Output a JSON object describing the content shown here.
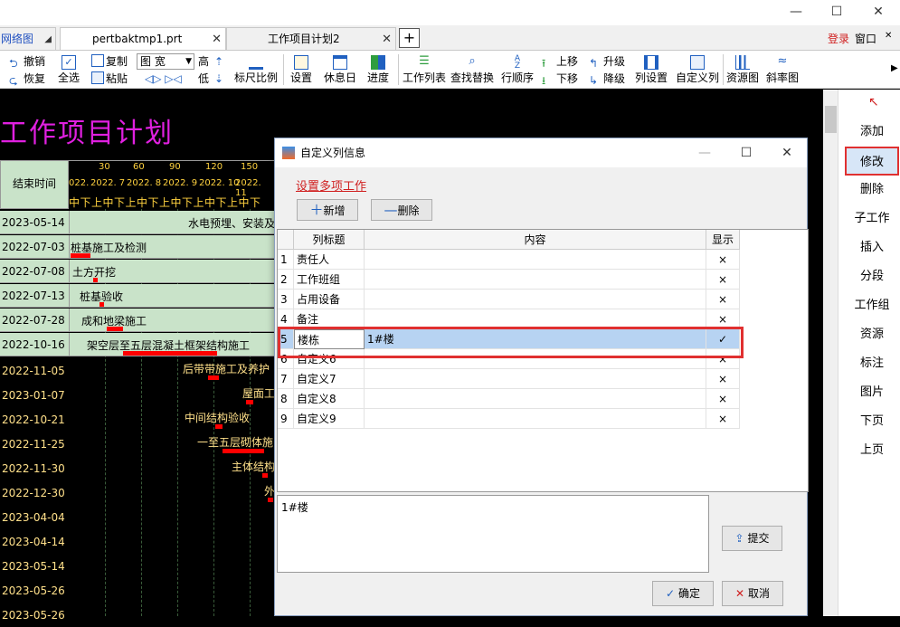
{
  "tabs": {
    "left_partial": "网络图",
    "file_tab": "pertbaktmp1.prt",
    "plan_tab": "工作项目计划2",
    "new_tab": "+",
    "login": "登录",
    "window": "窗口"
  },
  "toolbar": {
    "undo": "撤销",
    "redo": "恢复",
    "select_all": "全选",
    "copy": "复制",
    "paste": "粘贴",
    "view_select": "图  宽",
    "high": "高",
    "low": "低",
    "ruler": "标尺比例",
    "settings": "设置",
    "holiday": "休息日",
    "progress": "进度",
    "work_list": "工作列表",
    "find_replace": "查找替换",
    "row_order": "行顺序",
    "move_up": "上移",
    "move_down": "下移",
    "upgrade": "升级",
    "downgrade": "降级",
    "col_settings": "列设置",
    "custom_col": "自定义列",
    "resource_chart": "资源图",
    "slope_chart": "斜率图"
  },
  "gantt": {
    "title": "工作项目计划",
    "end_time_header": "结束时间",
    "scale_numbers": [
      "30",
      "60",
      "90",
      "120",
      "150"
    ],
    "scale_months": [
      "022.",
      "2022. 7",
      "2022. 8",
      "2022. 9",
      "2022. 10",
      "2022. 11"
    ],
    "scale_periods": [
      "中下上中下上中下上中下上中下上中下"
    ],
    "rows": [
      {
        "date": "2023-05-14",
        "task": "水电预埋、安装及",
        "style": "light"
      },
      {
        "date": "2022-07-03",
        "task": "桩基施工及检测",
        "style": "light"
      },
      {
        "date": "2022-07-08",
        "task": "土方开挖",
        "style": "light"
      },
      {
        "date": "2022-07-13",
        "task": "桩基验收",
        "style": "light"
      },
      {
        "date": "2022-07-28",
        "task": "成和地梁施工",
        "style": "light"
      },
      {
        "date": "2022-10-16",
        "task": "架空层至五层混凝土框架结构施工",
        "style": "light"
      },
      {
        "date": "2022-11-05",
        "task": "后带带施工及养护",
        "style": "dark"
      },
      {
        "date": "2023-01-07",
        "task": "屋面工",
        "style": "dark"
      },
      {
        "date": "2022-10-21",
        "task": "中间结构验收",
        "style": "dark"
      },
      {
        "date": "2022-11-25",
        "task": "一至五层砌体施",
        "style": "dark"
      },
      {
        "date": "2022-11-30",
        "task": "主体结构",
        "style": "dark"
      },
      {
        "date": "2022-12-30",
        "task": "外",
        "style": "dark"
      },
      {
        "date": "2023-04-04",
        "task": "",
        "style": "dark"
      },
      {
        "date": "2023-04-14",
        "task": "",
        "style": "dark"
      },
      {
        "date": "2023-05-14",
        "task": "",
        "style": "dark"
      },
      {
        "date": "2023-05-26",
        "task": "",
        "style": "dark"
      },
      {
        "date": "2023-05-26",
        "task": "",
        "style": "dark"
      }
    ]
  },
  "right_panel": {
    "items": [
      "添加",
      "修改",
      "删除",
      "子工作",
      "插入",
      "分段",
      "工作组",
      "资源",
      "标注",
      "图片",
      "下页",
      "上页"
    ],
    "selected": "修改"
  },
  "dialog": {
    "title": "自定义列信息",
    "sub_link": "设置多项工作",
    "add_button": "新增",
    "delete_button": "删除",
    "headers": [
      "列标题",
      "内容",
      "显示"
    ],
    "rows": [
      {
        "no": "1",
        "title": "责任人",
        "content": "",
        "show": "×"
      },
      {
        "no": "2",
        "title": "工作班组",
        "content": "",
        "show": "×"
      },
      {
        "no": "3",
        "title": "占用设备",
        "content": "",
        "show": "×"
      },
      {
        "no": "4",
        "title": "备注",
        "content": "",
        "show": "×"
      },
      {
        "no": "5",
        "title": "楼栋",
        "content": "1#楼",
        "show": "✓"
      },
      {
        "no": "6",
        "title": "自定义6",
        "content": "",
        "show": "×"
      },
      {
        "no": "7",
        "title": "自定义7",
        "content": "",
        "show": "×"
      },
      {
        "no": "8",
        "title": "自定义8",
        "content": "",
        "show": "×"
      },
      {
        "no": "9",
        "title": "自定义9",
        "content": "",
        "show": "×"
      }
    ],
    "edit_text": "1#楼",
    "submit_button": "提交",
    "ok_button": "确定",
    "cancel_button": "取消"
  },
  "colors": {
    "gantt_bg": "#000000",
    "task_row_green": "#c9e3c9",
    "title_magenta": "#e020e0",
    "red_highlight": "#e03030",
    "selected_row": "#b7d3f2"
  }
}
